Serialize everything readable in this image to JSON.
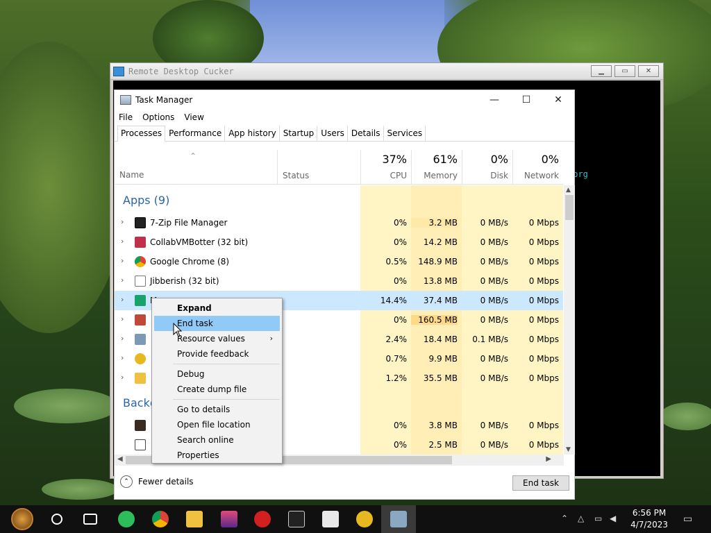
{
  "rdp": {
    "title": "Remote Desktop Cucker",
    "minimize": "▭",
    "maximize": "▭",
    "close": "☒"
  },
  "console_text": "Porg",
  "tm": {
    "title": "Task Manager",
    "win_min": "—",
    "win_max": "☐",
    "win_close": "✕",
    "menu": [
      "File",
      "Options",
      "View"
    ],
    "tabs": [
      "Processes",
      "Performance",
      "App history",
      "Startup",
      "Users",
      "Details",
      "Services"
    ],
    "header": {
      "name": "Name",
      "status": "Status",
      "cpu_pct": "37%",
      "cpu": "CPU",
      "mem_pct": "61%",
      "mem": "Memory",
      "disk_pct": "0%",
      "disk": "Disk",
      "net_pct": "0%",
      "net": "Network"
    },
    "apps_group": "Apps (9)",
    "bg_group": "Backg",
    "rows": [
      {
        "name": "7-Zip File Manager",
        "cpu": "0%",
        "mem": "3.2 MB",
        "disk": "0 MB/s",
        "net": "0 Mbps"
      },
      {
        "name": "CollabVMBotter (32 bit)",
        "cpu": "0%",
        "mem": "14.2 MB",
        "disk": "0 MB/s",
        "net": "0 Mbps"
      },
      {
        "name": "Google Chrome (8)",
        "cpu": "0.5%",
        "mem": "148.9 MB",
        "disk": "0 MB/s",
        "net": "0 Mbps"
      },
      {
        "name": "Jibberish (32 bit)",
        "cpu": "0%",
        "mem": "13.8 MB",
        "disk": "0 MB/s",
        "net": "0 Mbps"
      },
      {
        "name": "M",
        "cpu": "14.4%",
        "mem": "37.4 MB",
        "disk": "0 MB/s",
        "net": "0 Mbps"
      },
      {
        "name": "",
        "cpu": "0%",
        "mem": "160.5 MB",
        "disk": "0 MB/s",
        "net": "0 Mbps"
      },
      {
        "name": "",
        "cpu": "2.4%",
        "mem": "18.4 MB",
        "disk": "0.1 MB/s",
        "net": "0 Mbps"
      },
      {
        "name": "",
        "cpu": "0.7%",
        "mem": "9.9 MB",
        "disk": "0 MB/s",
        "net": "0 Mbps"
      },
      {
        "name": "",
        "cpu": "1.2%",
        "mem": "35.5 MB",
        "disk": "0 MB/s",
        "net": "0 Mbps"
      }
    ],
    "bg_rows": [
      {
        "cpu": "0%",
        "mem": "3.8 MB",
        "disk": "0 MB/s",
        "net": "0 Mbps"
      },
      {
        "cpu": "0%",
        "mem": "2.5 MB",
        "disk": "0 MB/s",
        "net": "0 Mbps"
      }
    ],
    "fewer_details": "Fewer details",
    "end_task": "End task"
  },
  "context_menu": {
    "expand": "Expand",
    "end_task": "End task",
    "resource_values": "Resource values",
    "provide_feedback": "Provide feedback",
    "debug": "Debug",
    "create_dump": "Create dump file",
    "go_to_details": "Go to details",
    "open_file_location": "Open file location",
    "search_online": "Search online",
    "properties": "Properties"
  },
  "taskbar": {
    "time": "6:56 PM",
    "date": "4/7/2023"
  },
  "colors": {
    "heat_light": "#fff4c4",
    "heat_mid": "#ffe9a8",
    "heat_strong": "#ffd98a",
    "selection": "#cce8ff",
    "menu_hot": "#91c9f7"
  }
}
